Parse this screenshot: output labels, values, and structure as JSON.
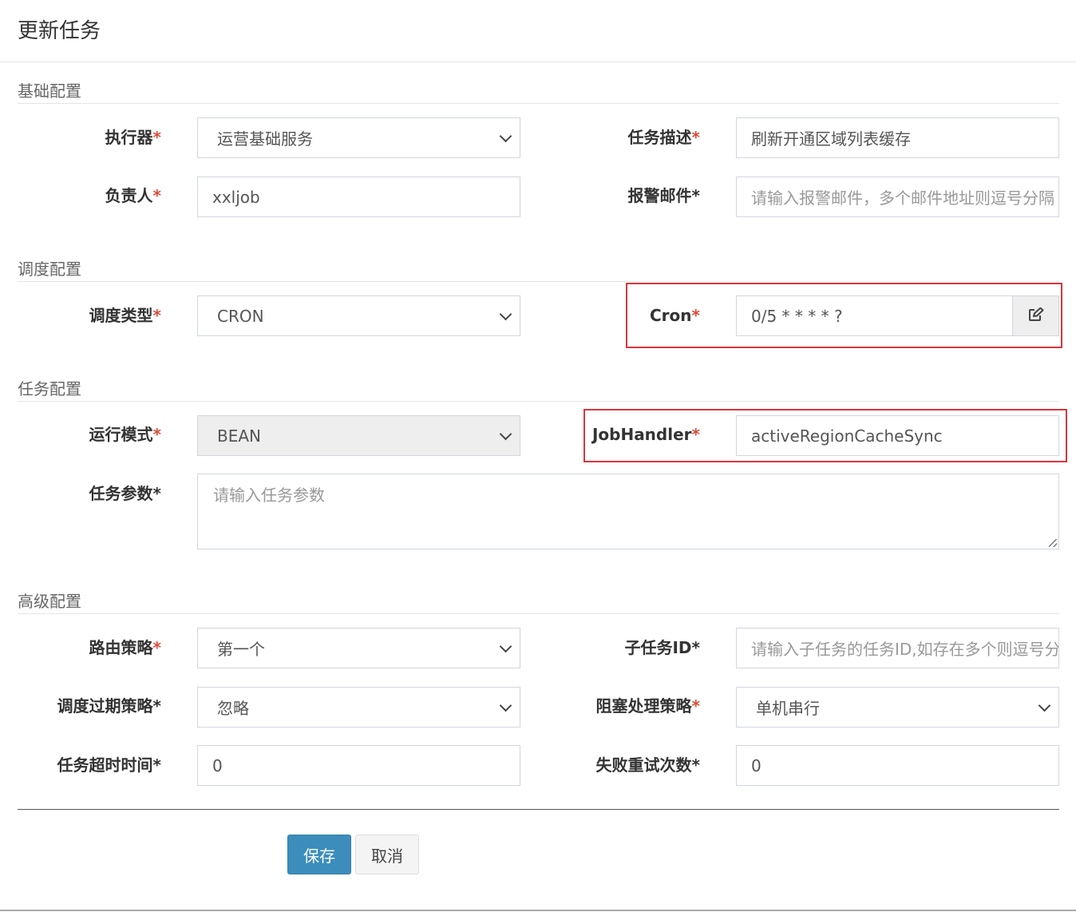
{
  "header": {
    "title": "更新任务"
  },
  "sections": {
    "basic": "基础配置",
    "schedule": "调度配置",
    "job": "任务配置",
    "advanced": "高级配置"
  },
  "fields": {
    "executor": {
      "label": "执行器",
      "value": "运营基础服务"
    },
    "job_desc": {
      "label": "任务描述",
      "value": "刷新开通区域列表缓存"
    },
    "author": {
      "label": "负责人",
      "value": "xxljob"
    },
    "alarm_email": {
      "label": "报警邮件",
      "placeholder": "请输入报警邮件，多个邮件地址则逗号分隔"
    },
    "schedule_type": {
      "label": "调度类型",
      "value": "CRON"
    },
    "cron": {
      "label": "Cron",
      "value": "0/5 * * * * ?"
    },
    "glue_type": {
      "label": "运行模式",
      "value": "BEAN"
    },
    "job_handler": {
      "label": "JobHandler",
      "value": "activeRegionCacheSync"
    },
    "job_param": {
      "label": "任务参数",
      "placeholder": "请输入任务参数"
    },
    "route_strategy": {
      "label": "路由策略",
      "value": "第一个"
    },
    "child_job_id": {
      "label": "子任务ID",
      "placeholder": "请输入子任务的任务ID,如存在多个则逗号分隔"
    },
    "misfire_strategy": {
      "label": "调度过期策略",
      "value": "忽略"
    },
    "block_strategy": {
      "label": "阻塞处理策略",
      "value": "单机串行"
    },
    "timeout": {
      "label": "任务超时时间",
      "value": "0"
    },
    "fail_retry": {
      "label": "失败重试次数",
      "value": "0"
    }
  },
  "required_mark": "*",
  "buttons": {
    "save": "保存",
    "cancel": "取消"
  },
  "icons": {
    "cron_edit": "edit-icon"
  },
  "colors": {
    "required": "#dd4b39",
    "primary": "#3c8dbc",
    "highlight": "#d9363e"
  }
}
